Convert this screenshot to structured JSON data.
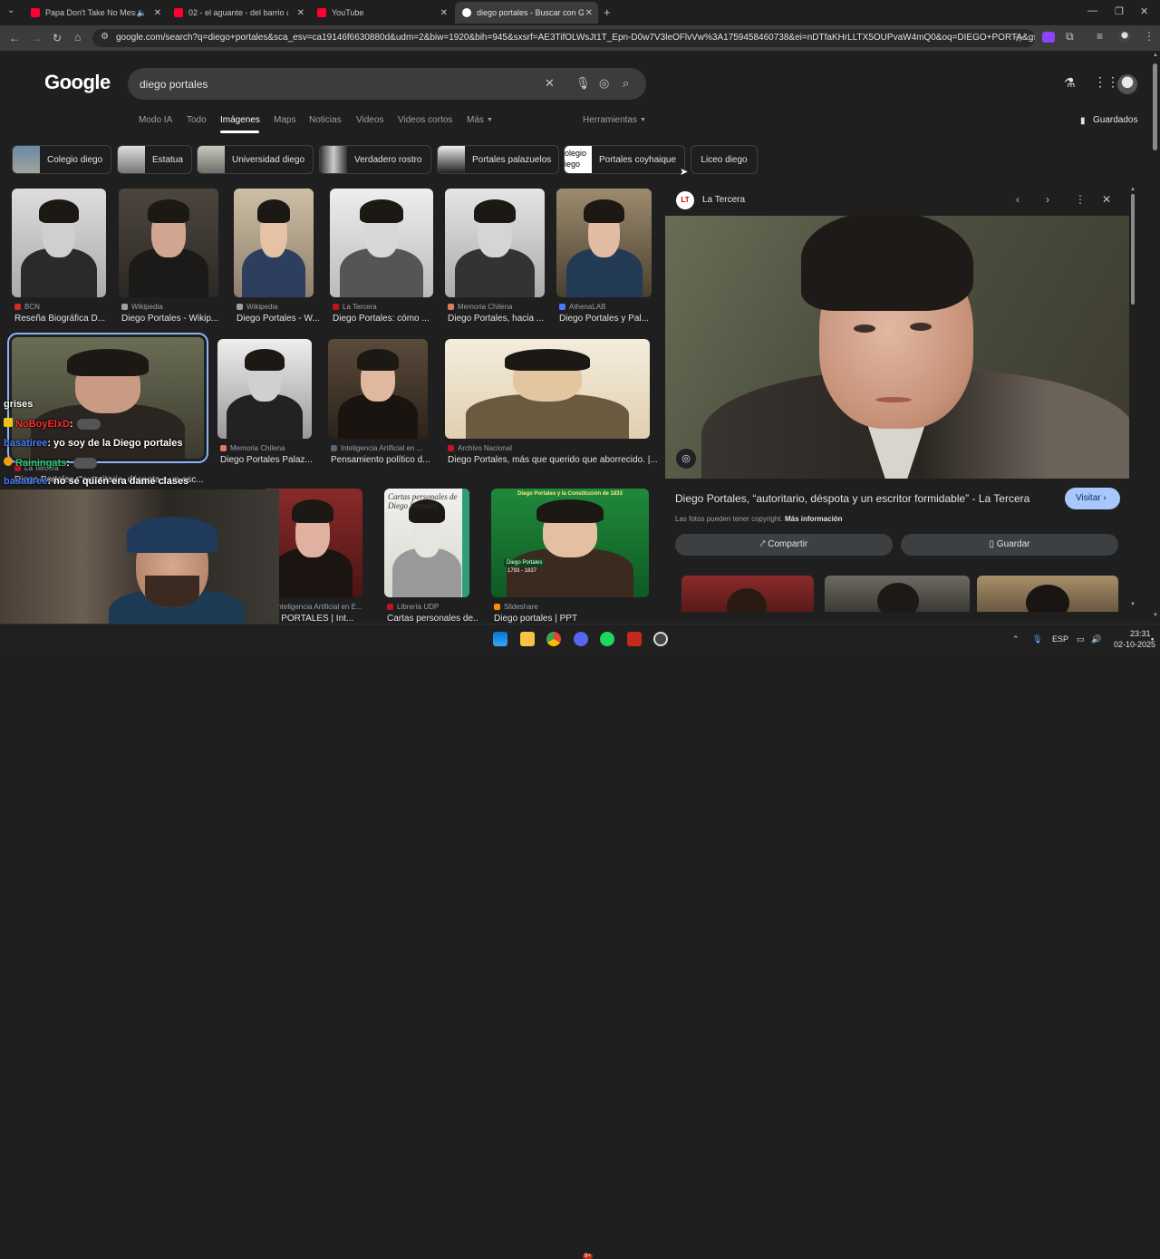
{
  "browser": {
    "tabs": [
      {
        "label": "Papa Don't Take No Mess ·",
        "favicon_color": "#ff0033"
      },
      {
        "label": "02 - el aguante - del barrio al t",
        "favicon_color": "#ff0033"
      },
      {
        "label": "YouTube",
        "favicon_color": "#ff0033"
      },
      {
        "label": "diego portales - Buscar con Go",
        "favicon_color": "#4285f4"
      }
    ],
    "url": "google.com/search?q=diego+portales&sca_esv=ca19146f6630880d&udm=2&biw=1920&bih=945&sxsrf=AE3TifOLWsJt1T_Epn-D0w7V3leOFlvVw%3A1759458460738&ei=nDTfaKHrLLTX5OUPvaW4mQ0&oq=DIEGO+PORTA&gs_lp=Egtn..."
  },
  "google": {
    "logo": "Google",
    "query": "diego portales",
    "nav_tabs": [
      "Modo IA",
      "Todo",
      "Imágenes",
      "Maps",
      "Noticias",
      "Videos",
      "Videos cortos",
      "Más"
    ],
    "tools": "Herramientas",
    "saved": "Guardados",
    "chips": [
      "Colegio diego",
      "Estatua",
      "Universidad diego",
      "Verdadero rostro",
      "Portales palazuelos",
      "Portales coyhaique",
      "Liceo diego"
    ],
    "chip_overlay_text": "olegio\niego",
    "results_row1": [
      {
        "source": "BCN",
        "caption": "Reseña Biográfica D..."
      },
      {
        "source": "Wikipedia",
        "caption": "Diego Portales - Wikip..."
      },
      {
        "source": "Wikipedia",
        "caption": "Diego Portales - W..."
      },
      {
        "source": "La Tercera",
        "caption": "Diego Portales: cómo ..."
      },
      {
        "source": "Memoria Chilena",
        "caption": "Diego Portales, hacia ..."
      },
      {
        "source": "AthenaLAB",
        "caption": "Diego Portales y Pal..."
      }
    ],
    "results_row2": [
      {
        "source": "La Tercera",
        "caption": "Diego Portales, \"autoritario, déspota y un esc..."
      },
      {
        "source": "Memoria Chilena",
        "caption": "Diego Portales Palaz..."
      },
      {
        "source": "Inteligencia Artificial en ...",
        "caption": "Pensamiento político d..."
      },
      {
        "source": "Archivo Nacional",
        "caption": "Diego Portales, más que querido que aborrecido. |..."
      }
    ],
    "results_row3": [
      {
        "source": "Inteligencia Artificial en E...",
        "caption": "SO PORTALES | Int..."
      },
      {
        "source": "Librería UDP",
        "caption": "Cartas personales de..."
      },
      {
        "source": "Slideshare",
        "caption": "Diego portales | PPT"
      }
    ],
    "book_text": "Cartas personales de Diego Portales",
    "slide_title": "Diego Portales y la Constitución de 1833",
    "slide_name": "Diego Portales",
    "slide_years": "1793 - 1837"
  },
  "panel": {
    "source": "La Tercera",
    "source_badge": "LT",
    "title": "Diego Portales, “autoritario, déspota y un escritor formidable” - La Tercera",
    "visit": "Visitar",
    "copyright": "Las fotos pueden tener copyright.",
    "more_info": "Más información",
    "share": "Compartir",
    "save": "Guardar"
  },
  "chat": [
    {
      "text": "grises",
      "color": "#ffffff"
    },
    {
      "user": "NoBoyElxD",
      "text": ":",
      "color": "#ff2a2a"
    },
    {
      "user": "basatiree",
      "text": ": yo soy de la Diego portales",
      "color": "#4a7bff"
    },
    {
      "user": "Rainingats",
      "text": ":",
      "color": "#2ecc71"
    },
    {
      "user": "basatiree",
      "text": ": no sé quién era dame clases",
      "color": "#4a7bff"
    }
  ],
  "taskbar": {
    "lang": "ESP",
    "time": "23:31",
    "date": "02-10-2025",
    "discord_badge": "9+"
  }
}
